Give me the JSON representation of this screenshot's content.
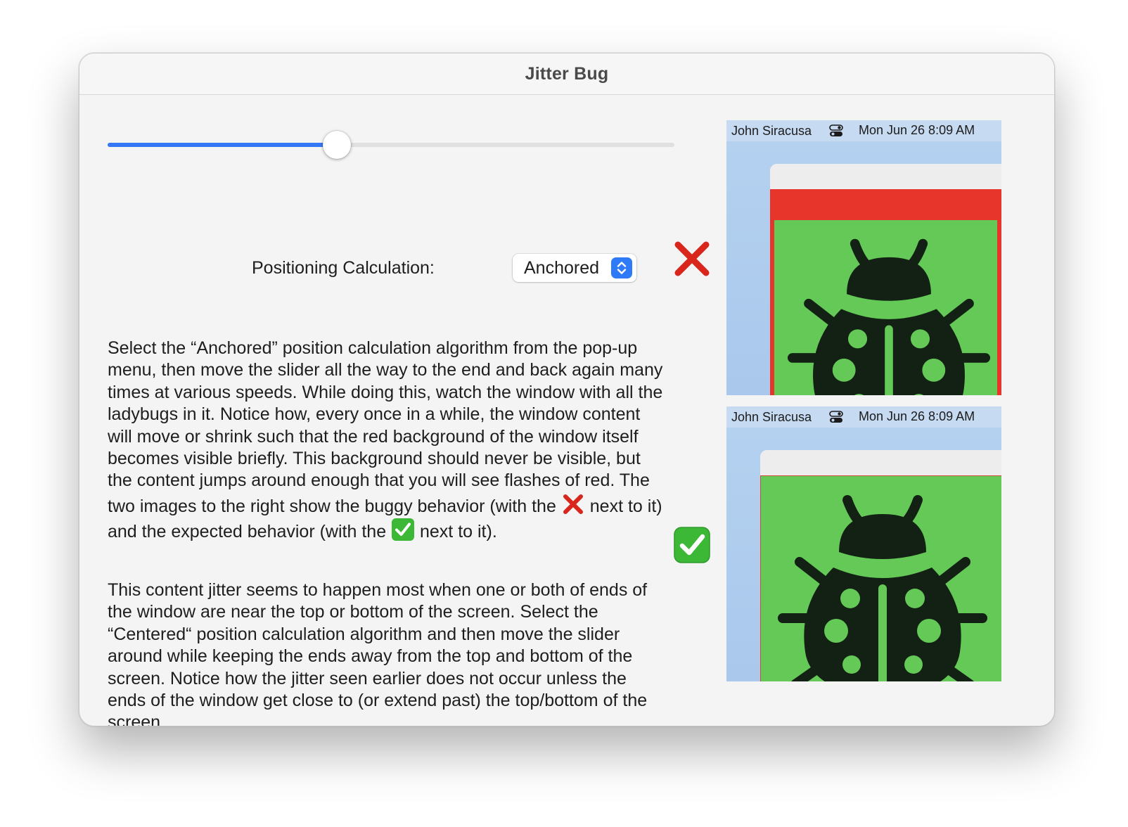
{
  "window": {
    "title": "Jitter Bug"
  },
  "slider": {
    "value_fraction": 0.405
  },
  "positioning": {
    "label": "Positioning Calculation:",
    "selected": "Anchored"
  },
  "instructions": {
    "para1_before_x": "Select the “Anchored” position calculation algorithm from the pop-up menu, then move the slider all the way to the end and back again many times at various speeds. While doing this, watch the window with all the ladybugs in it. Notice how, every once in a while, the window content will move or shrink such that the red background of the window itself becomes visible briefly. This background should never be visible, but the content jumps around enough that you will see flashes of red. The two images to the right show the buggy behavior (with the",
    "para1_between": "next to it) and the expected behavior (with the",
    "para1_after_check": "next to it).",
    "para2": "This content jitter seems to happen most when one or both of ends of the window are near the top or bottom of the screen. Select the “Centered“ position calculation algorithm and then move the slider around while keeping the ends away from the top and bottom of the screen. Notice how the jitter seen earlier does not occur unless the ends of the window get close to (or extend past) the top/bottom of the screen."
  },
  "markers": {
    "buggy_icon": "cross-mark-icon",
    "expected_icon": "check-mark-icon"
  },
  "screenshots": {
    "buggy": {
      "menubar_user": "John Siracusa",
      "menubar_clock": "Mon Jun 26  8:09 AM"
    },
    "expected": {
      "menubar_user": "John Siracusa",
      "menubar_clock": "Mon Jun 26  8:09 AM"
    }
  },
  "colors": {
    "accent": "#3478f6",
    "window_background_red": "#e7352b",
    "content_green": "#64c956",
    "ladybug": "#122114",
    "cross_red": "#d9261c",
    "check_green": "#3cb836"
  }
}
